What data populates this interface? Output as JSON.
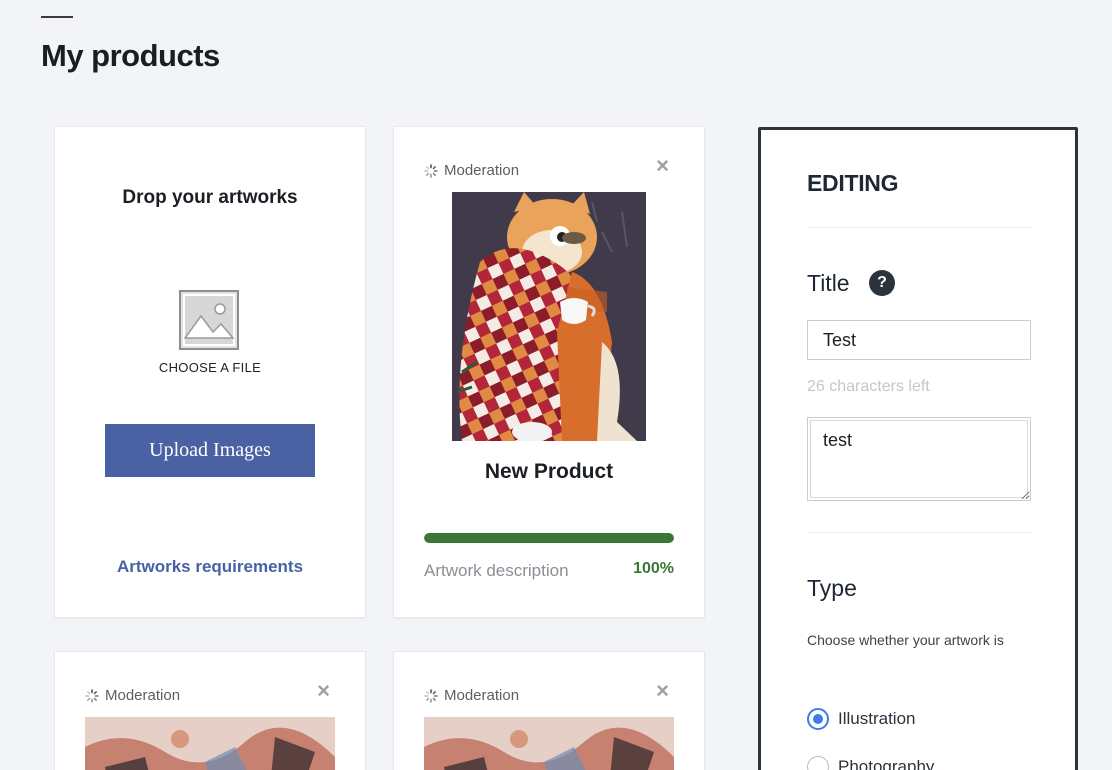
{
  "page": {
    "title": "My products"
  },
  "upload": {
    "heading": "Drop your artworks",
    "choose_file": "CHOOSE A FILE",
    "button": "Upload Images",
    "requirements_link": "Artworks requirements"
  },
  "products": [
    {
      "status": "Moderation",
      "close": "×",
      "name": "New Product",
      "progress_label": "Artwork description",
      "progress_value": "100%",
      "progress_fraction": 1.0
    },
    {
      "status": "Moderation",
      "close": "×"
    },
    {
      "status": "Moderation",
      "close": "×"
    }
  ],
  "editing": {
    "heading": "EDITING",
    "title_label": "Title",
    "help_icon": "?",
    "title_value": "Test",
    "chars_left": "26 characters left",
    "description_value": "test",
    "type_label": "Type",
    "type_hint": "Choose whether your artwork is",
    "options": [
      {
        "label": "Illustration",
        "checked": true
      },
      {
        "label": "Photography",
        "checked": false
      }
    ]
  },
  "colors": {
    "accent_blue": "#4a62a3",
    "link_blue": "#4562a6",
    "progress_green": "#3b7734",
    "radio_blue": "#3d7bf2",
    "panel_border": "#2b333d"
  },
  "icons": {
    "placeholder": "image-placeholder-icon",
    "status": "spinner-icon",
    "close": "close-icon",
    "help": "help-icon"
  }
}
